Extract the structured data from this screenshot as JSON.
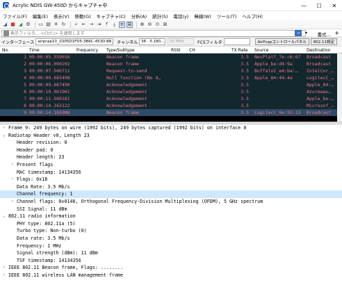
{
  "window": {
    "title": "Acrylic NDIS GW-450D からキャプチャ中",
    "min": "—",
    "max": "☐",
    "close": "✕"
  },
  "menu": [
    "ファイル(F)",
    "編集(E)",
    "表示(V)",
    "移動(G)",
    "キャプチャ(C)",
    "分析(A)",
    "統計(S)",
    "電話(y)",
    "無線(W)",
    "ツール(T)",
    "ヘルプ(H)"
  ],
  "filter": {
    "placeholder": "表示フィルタ… <Ctrl-/> を適用します",
    "expression": "書式…"
  },
  "interface_bar": {
    "interface_label": "インターフェース",
    "interface_value": "airpcap10_{D05D1FD5-3B6C-453D-B8…",
    "channel_label": "チャンネル",
    "channel_value": "36 · 5.180…",
    "width_value": "20 MHz",
    "fcs_label": "FCSフィルタ",
    "fcs_value": "",
    "airpcap_button": "AirPcapコントロールパネル",
    "settings_button": "802.11設定"
  },
  "packet_list": {
    "columns": [
      "No.",
      "Time",
      "Frequency",
      "Type/Subtype",
      "RSSI",
      "CH",
      "TX Rate",
      "Source",
      "Destination"
    ],
    "rows": [
      [
        "1",
        "09:00:05.559016",
        "",
        "Beacon frame",
        "",
        "",
        "3.5",
        "NecPlatf_7e:c6:67",
        "Broadcast"
      ],
      [
        "2",
        "09:00:06.090202",
        "",
        "Beacon frame",
        "",
        "",
        "3.5",
        "Apple_be:d4:9a",
        "Broadcast"
      ],
      [
        "3",
        "09:00:07.506711",
        "",
        "Request-to-send",
        "",
        "",
        "3.5",
        "BuffaloI_e4:ba:…",
        "IntelCor_…"
      ],
      [
        "4",
        "09:00:09.665498",
        "",
        "Null function (No d…",
        "",
        "",
        "3.5",
        "Apple_84:44:4a",
        "LogitecC_…"
      ],
      [
        "5",
        "09:00:09.667490",
        "",
        "Acknowledgement",
        "",
        "",
        "3.5",
        "",
        "Apple_84:…"
      ],
      [
        "6",
        "09:00:10.961961",
        "",
        "Acknowledgement",
        "",
        "",
        "3.5",
        "",
        "Azurewav…"
      ],
      [
        "7",
        "09:00:11.560181",
        "",
        "Acknowledgement",
        "",
        "",
        "3.5",
        "",
        "Apple_be:…"
      ],
      [
        "8",
        "09:00:14.162122",
        "",
        "Acknowledgement",
        "",
        "",
        "3.5",
        "",
        "Microsof_…"
      ],
      [
        "9",
        "09:00:14.165988",
        "",
        "Beacon frame",
        "",
        "",
        "3.5",
        "LogitecC_9e:92:13",
        "Broadcast"
      ]
    ]
  },
  "details": [
    {
      "indent": 0,
      "arrow": "›",
      "text": "Frame 9: 249 bytes on wire (1992 bits), 249 bytes captured (1992 bits) on interface 0"
    },
    {
      "indent": 0,
      "arrow": "⌄",
      "text": "Radiotap Header v0, Length 23"
    },
    {
      "indent": 1,
      "arrow": "",
      "text": "Header revision: 0"
    },
    {
      "indent": 1,
      "arrow": "",
      "text": "Header pad: 0"
    },
    {
      "indent": 1,
      "arrow": "",
      "text": "Header length: 23"
    },
    {
      "indent": 1,
      "arrow": "›",
      "text": "Present flags"
    },
    {
      "indent": 1,
      "arrow": "",
      "text": "MAC timestamp: 14134356"
    },
    {
      "indent": 1,
      "arrow": "›",
      "text": "Flags: 0x18"
    },
    {
      "indent": 1,
      "arrow": "",
      "text": "Data Rate: 3.5 Mb/s"
    },
    {
      "indent": 1,
      "arrow": "",
      "text": "Channel frequency: 1",
      "highlight": true
    },
    {
      "indent": 1,
      "arrow": "›",
      "text": "Channel flags: 0x0140, Orthogonal Frequency-Division Multiplexing (OFDM), 5 GHz spectrum"
    },
    {
      "indent": 1,
      "arrow": "",
      "text": "SSI Signal: 11 dBm"
    },
    {
      "indent": 0,
      "arrow": "⌄",
      "text": "802.11 radio information"
    },
    {
      "indent": 1,
      "arrow": "",
      "text": "PHY type: 802.11a (5)"
    },
    {
      "indent": 1,
      "arrow": "",
      "text": "Turbo type: Non-turbo (0)"
    },
    {
      "indent": 1,
      "arrow": "",
      "text": "Data rate: 3.5 Mb/s"
    },
    {
      "indent": 1,
      "arrow": "",
      "text": "Frequency: 1 MHz"
    },
    {
      "indent": 1,
      "arrow": "",
      "text": "Signal strength (dBm): 11 dBm"
    },
    {
      "indent": 1,
      "arrow": "",
      "text": "TSF timestamp: 14134356"
    },
    {
      "indent": 0,
      "arrow": "›",
      "text": "IEEE 802.11 Beacon frame, Flags: ........"
    },
    {
      "indent": 0,
      "arrow": "›",
      "text": "IEEE 802.11 wireless LAN management frame"
    }
  ],
  "colors": {
    "row_bg": "#12272e",
    "row_fg": "#f4788c",
    "selected_row_bg": "#2f4c66",
    "highlight_detail": "#cde8ff"
  }
}
